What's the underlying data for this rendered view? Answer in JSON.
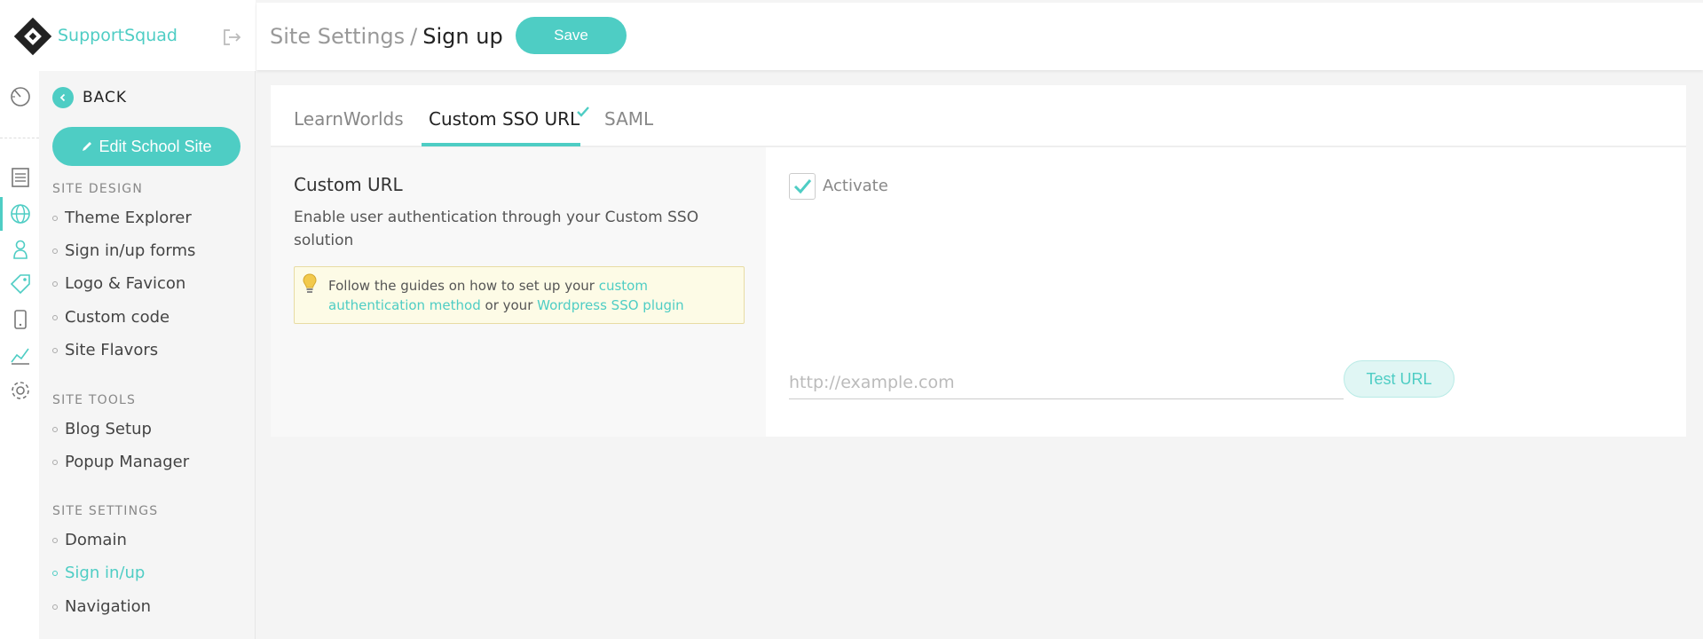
{
  "brand": {
    "name": "SupportSquad"
  },
  "rail": {
    "icons": [
      "dashboard-icon",
      "pages-icon",
      "globe-icon",
      "users-icon",
      "tag-icon",
      "mobile-icon",
      "reports-icon",
      "settings-icon"
    ]
  },
  "sidebar": {
    "back_label": "BACK",
    "edit_label": "Edit School Site",
    "sections": [
      {
        "title": "SITE DESIGN",
        "items": [
          "Theme Explorer",
          "Sign in/up forms",
          "Logo & Favicon",
          "Custom code",
          "Site Flavors"
        ]
      },
      {
        "title": "SITE TOOLS",
        "items": [
          "Blog Setup",
          "Popup Manager"
        ]
      },
      {
        "title": "SITE SETTINGS",
        "items": [
          "Domain",
          "Sign in/up",
          "Navigation"
        ]
      }
    ],
    "active_item": "Sign in/up"
  },
  "header": {
    "parent": "Site Settings",
    "separator": "/",
    "current": "Sign up",
    "save_label": "Save"
  },
  "tabs": [
    {
      "label": "LearnWorlds",
      "active": false
    },
    {
      "label": "Custom SSO URL",
      "active": true,
      "checked": true
    },
    {
      "label": "SAML",
      "active": false
    }
  ],
  "custom_url": {
    "heading": "Custom URL",
    "description": "Enable user authentication through your Custom SSO solution",
    "info_prefix": "Follow the guides on how to set up your ",
    "info_link1": "custom authentication method",
    "info_middle": " or your ",
    "info_link2": "Wordpress SSO plugin",
    "activate_label": "Activate",
    "activated": true,
    "url_placeholder": "http://example.com",
    "url_value": "",
    "test_label": "Test URL"
  },
  "colors": {
    "accent": "#4ecdc4",
    "info_bg": "#fdfbe6"
  }
}
